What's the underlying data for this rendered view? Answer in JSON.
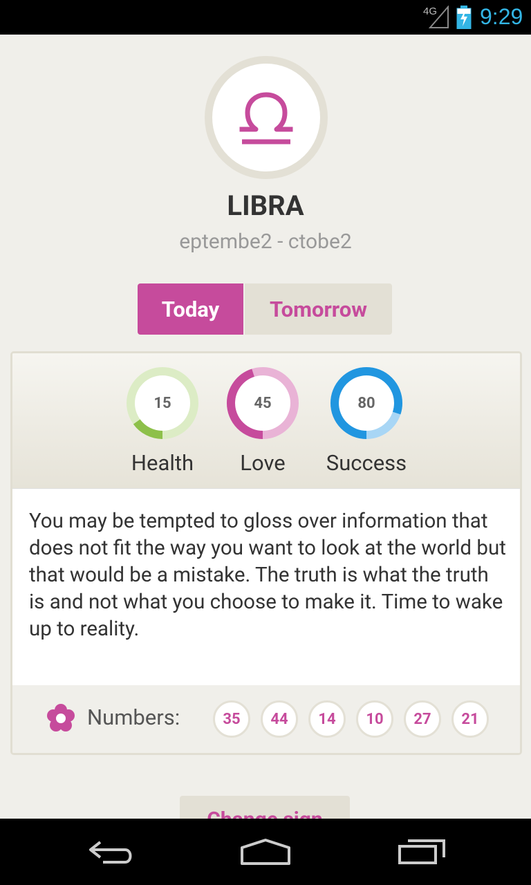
{
  "status_bar": {
    "network": "4G",
    "time": "9:29"
  },
  "sign": {
    "name": "LIBRA",
    "dates": "eptembe2 - ctobe2"
  },
  "tabs": {
    "today": "Today",
    "tomorrow": "Tomorrow"
  },
  "meters": [
    {
      "label": "Health",
      "value": "15",
      "percent": 15,
      "color": "#8dc04a",
      "track": "#dcecc5"
    },
    {
      "label": "Love",
      "value": "45",
      "percent": 45,
      "color": "#c64b9c",
      "track": "#e9b3d6"
    },
    {
      "label": "Success",
      "value": "80",
      "percent": 80,
      "color": "#2196e0",
      "track": "#a8d6f5"
    }
  ],
  "description": "You may be tempted to gloss over information that does not fit the way you want to look at the world but that would be a mistake. The truth is what the truth is and not what you choose to make it. Time to wake up to reality.",
  "numbers": {
    "label": "Numbers:",
    "values": [
      "35",
      "44",
      "14",
      "10",
      "27",
      "21"
    ]
  },
  "change_button": "Change sign",
  "colors": {
    "accent": "#c64b9c",
    "beige": "#e3e0d5"
  }
}
